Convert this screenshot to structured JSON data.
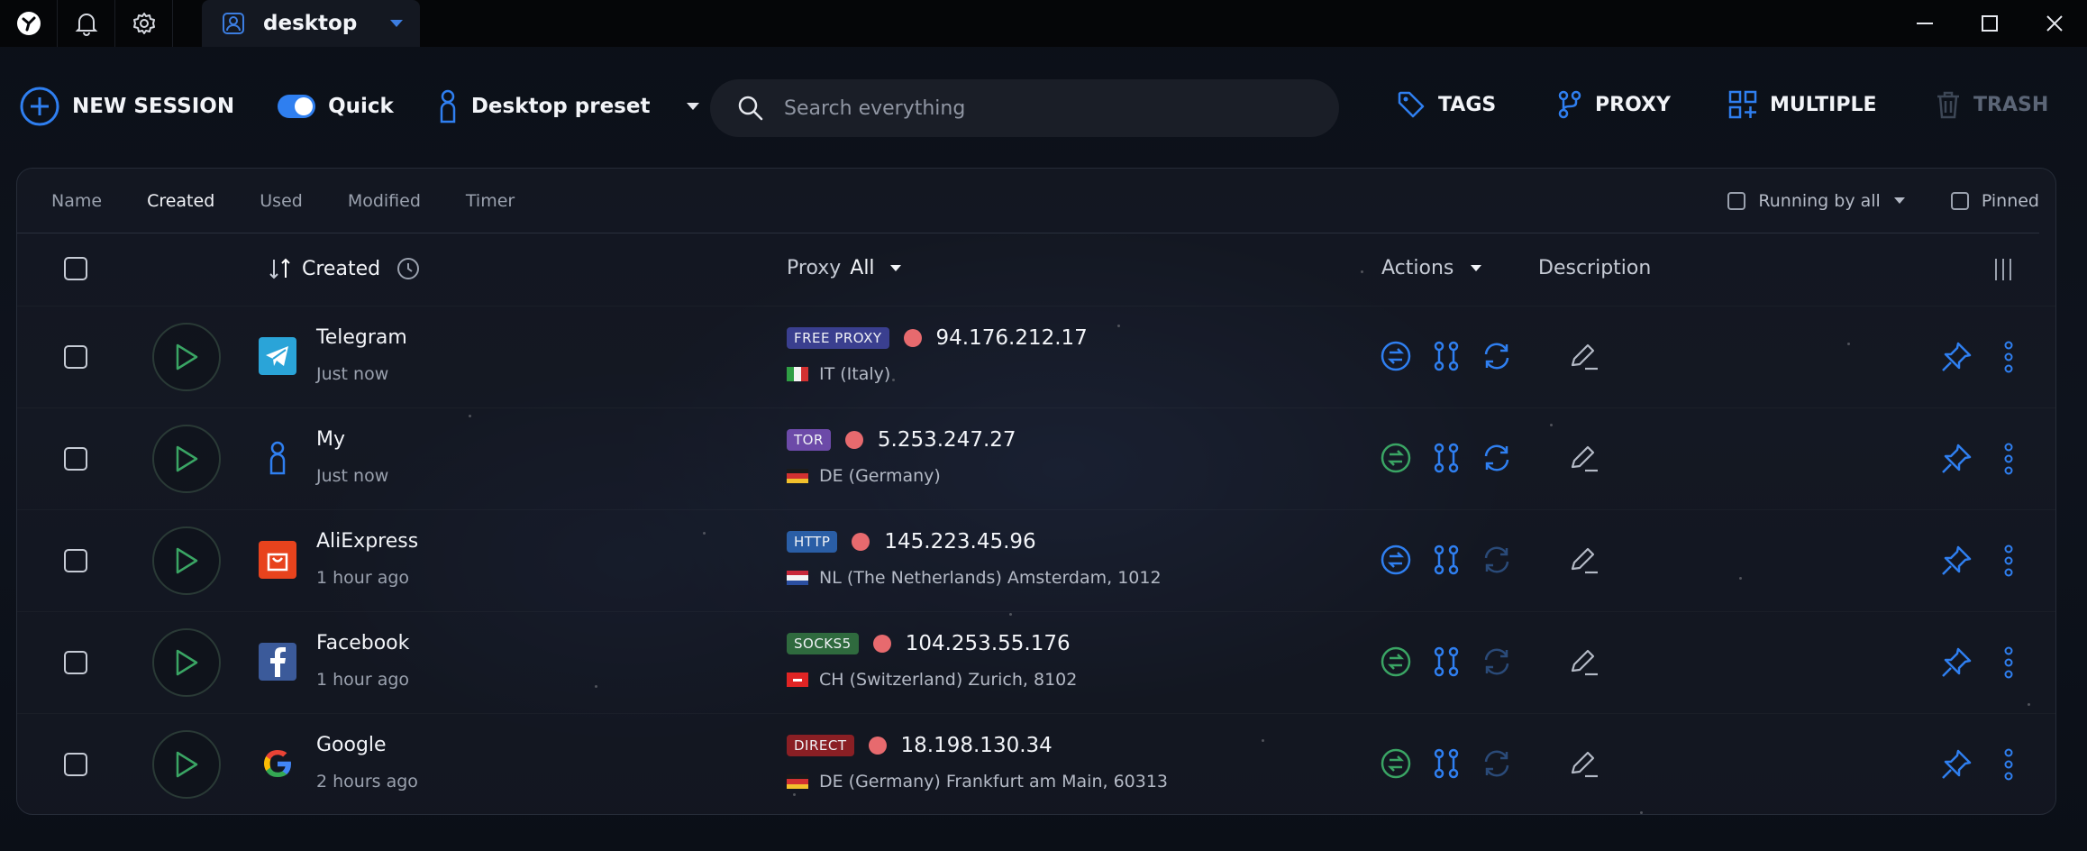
{
  "titlebar": {
    "tab_label": "desktop"
  },
  "toolbar": {
    "new_session": "NEW SESSION",
    "quick": "Quick",
    "quick_on": true,
    "preset": "Desktop preset",
    "search_placeholder": "Search everything",
    "tags": "TAGS",
    "proxy": "PROXY",
    "multiple": "MULTIPLE",
    "trash": "TRASH"
  },
  "sortbar": {
    "tabs": [
      "Name",
      "Created",
      "Used",
      "Modified",
      "Timer"
    ],
    "active": "Created",
    "running_by_all": "Running by all",
    "pinned": "Pinned"
  },
  "table": {
    "col_created": "Created",
    "col_proxy": "Proxy",
    "col_proxy_filter": "All",
    "col_actions": "Actions",
    "col_description": "Description",
    "rows": [
      {
        "name": "Telegram",
        "time": "Just now",
        "badge": "FREE PROXY",
        "ip": "94.176.212.17",
        "location": "IT (Italy)",
        "icon": "telegram-icon",
        "badge_color": "#3a3f8f"
      },
      {
        "name": "My",
        "time": "Just now",
        "badge": "TOR",
        "ip": "5.253.247.27",
        "location": "DE (Germany)",
        "icon": "person-icon",
        "badge_color": "#6c4aa8"
      },
      {
        "name": "AliExpress",
        "time": "1 hour ago",
        "badge": "HTTP",
        "ip": "145.223.45.96",
        "location": "NL (The Netherlands) Amsterdam, 1012",
        "icon": "aliexpress-icon",
        "badge_color": "#2a5ea6"
      },
      {
        "name": "Facebook",
        "time": "1 hour ago",
        "badge": "SOCKS5",
        "ip": "104.253.55.176",
        "location": "CH (Switzerland) Zurich, 8102",
        "icon": "facebook-icon",
        "badge_color": "#2f6a3e"
      },
      {
        "name": "Google",
        "time": "2 hours ago",
        "badge": "DIRECT",
        "ip": "18.198.130.34",
        "location": "DE (Germany) Frankfurt am Main, 60313",
        "icon": "google-icon",
        "badge_color": "#8a1f24"
      }
    ]
  }
}
